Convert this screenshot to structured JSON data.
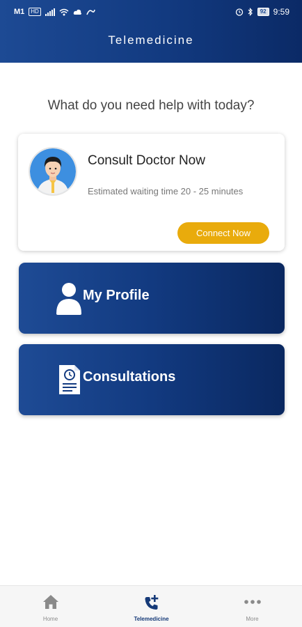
{
  "status_bar": {
    "carrier": "M1",
    "network_badge": "HD",
    "battery": "92",
    "time": "9:59"
  },
  "header": {
    "title": "Telemedicine"
  },
  "main": {
    "question": "What do you need help with today?",
    "consult_card": {
      "title": "Consult Doctor Now",
      "wait_text": "Estimated waiting time 20 - 25 minutes",
      "button_label": "Connect Now"
    },
    "profile_card": {
      "label": "My Profile",
      "icon": "user-icon"
    },
    "consultations_card": {
      "label": "Consultations",
      "icon": "document-clock-icon"
    }
  },
  "bottom_nav": {
    "items": [
      {
        "label": "Home",
        "icon": "home-icon",
        "active": false
      },
      {
        "label": "Telemedicine",
        "icon": "phone-plus-icon",
        "active": true
      },
      {
        "label": "More",
        "icon": "more-dots-icon",
        "active": false
      }
    ]
  },
  "colors": {
    "primary": "#123a80",
    "accent": "#e9ab0c",
    "active_tab": "#163a78"
  }
}
